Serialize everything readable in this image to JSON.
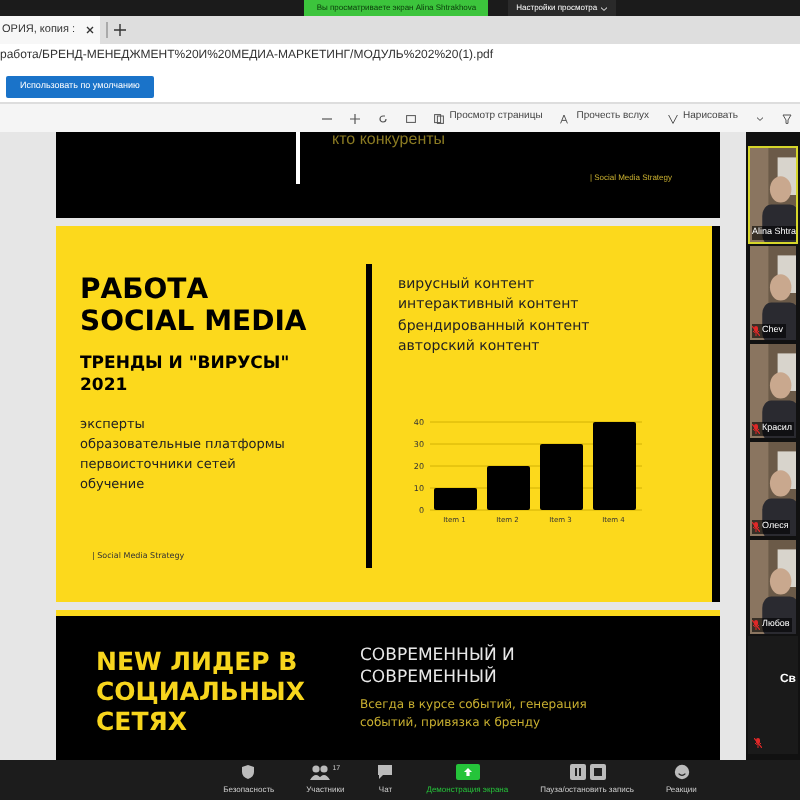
{
  "share_banner": {
    "text": "Вы просматриваете экран Alina Shtrakhova",
    "settings": "Настройки просмотра"
  },
  "browser": {
    "tabs": [
      {
        "label": "ОРИЯ, копия :",
        "selected": true
      }
    ],
    "address": "работа/БРЕНД-МЕНЕДЖМЕНТ%20И%20МЕДИА-МАРКЕТИНГ/МОДУЛЬ%202%20(1).pdf",
    "default_button": "Использовать по умолчанию"
  },
  "pdf_toolbar": {
    "page_view": "Просмотр страницы",
    "read_aloud": "Прочесть вслух",
    "draw": "Нарисовать"
  },
  "slides": [
    {
      "kind": "ending",
      "text": "кто конкуренты",
      "footer": "| Social Media Strategy"
    },
    {
      "kind": "trends",
      "title": [
        "РАБОТА",
        "SOCIAL MEDIA"
      ],
      "subtitle": [
        "ТРЕНДЫ И \"ВИРУСЫ\"",
        "2021"
      ],
      "list": [
        "эксперты",
        "образовательные платформы",
        "первоисточники сетей",
        "обучение"
      ],
      "footer": "| Social Media Strategy",
      "content": [
        "вирусный контент",
        "интерактивный контент",
        "брендированный контент",
        "авторский контент"
      ],
      "chart_data": {
        "type": "bar",
        "categories": [
          "Item 1",
          "Item 2",
          "Item 3",
          "Item 4"
        ],
        "values": [
          10,
          20,
          30,
          40
        ],
        "ylim": [
          0,
          40
        ],
        "grid": true,
        "yticks": [
          0,
          10,
          20,
          30,
          40
        ]
      }
    },
    {
      "kind": "leader",
      "title": [
        "NEW ЛИДЕР В",
        "СОЦИАЛЬНЫХ",
        "СЕТЯХ"
      ],
      "heading": "СОВРЕМЕННЫЙ И СОВРЕМЕННЫЙ",
      "text": "Всегда в курсе событий, генерация событий, привязка к бренду"
    }
  ],
  "participants": [
    {
      "kind": "video",
      "name": "Alina Shtra",
      "active": true,
      "muted": false
    },
    {
      "kind": "video",
      "name": "Chev",
      "active": false,
      "muted": true
    },
    {
      "kind": "video",
      "name": "Красил",
      "active": false,
      "muted": true
    },
    {
      "kind": "video",
      "name": "Олеся",
      "active": false,
      "muted": true
    },
    {
      "kind": "video",
      "name": "Любов",
      "active": false,
      "muted": true
    },
    {
      "kind": "name",
      "name": "Св",
      "active": false,
      "muted": false
    },
    {
      "kind": "blank",
      "active": false,
      "muted": true
    }
  ],
  "meeting_toolbar": [
    {
      "kind": "security",
      "label": "Безопасность",
      "selected": false
    },
    {
      "kind": "participants",
      "label": "Участники",
      "count": "17",
      "selected": false
    },
    {
      "kind": "chat",
      "label": "Чат",
      "selected": false
    },
    {
      "kind": "share",
      "label": "Демонстрация экрана",
      "selected": true
    },
    {
      "kind": "record",
      "label": "Пауза/остановить запись",
      "selected": false
    },
    {
      "kind": "reactions",
      "label": "Реакции",
      "selected": false
    }
  ]
}
